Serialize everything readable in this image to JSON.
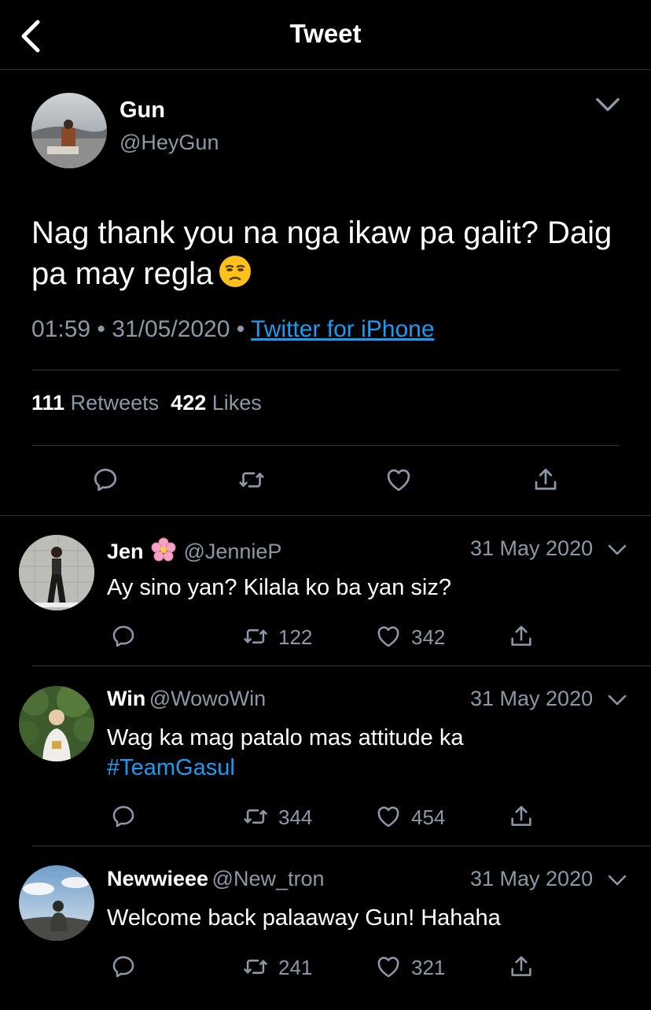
{
  "header": {
    "title": "Tweet"
  },
  "tweet": {
    "name": "Gun",
    "handle": "@HeyGun",
    "text": "Nag thank you na nga ikaw pa galit? Daig pa may regla",
    "emoji": "unamused-face",
    "time": "01:59",
    "date": "31/05/2020",
    "dot": "•",
    "source": "Twitter for iPhone",
    "retweets_count": "111",
    "retweets_label": "Retweets",
    "likes_count": "422",
    "likes_label": "Likes"
  },
  "replies": [
    {
      "name": "Jen",
      "badge_emoji": "cherry-blossom",
      "handle": "@JennieP",
      "date": "31 May 2020",
      "text": "Ay sino yan? Kilala ko ba yan siz?",
      "retweets": "122",
      "likes": "342"
    },
    {
      "name": "Win",
      "handle": "@WowoWin",
      "date": "31 May 2020",
      "text": "Wag ka mag patalo mas attitude ka",
      "hashtag": "#TeamGasul",
      "retweets": "344",
      "likes": "454"
    },
    {
      "name": "Newwieee",
      "handle": "@New_tron",
      "date": "31 May 2020",
      "text": "Welcome back palaaway Gun! Hahaha",
      "retweets": "241",
      "likes": "321"
    }
  ],
  "colors": {
    "background": "#000000",
    "link": "#1d9bf0",
    "muted": "#8b98a5",
    "separator": "#2f3336"
  }
}
